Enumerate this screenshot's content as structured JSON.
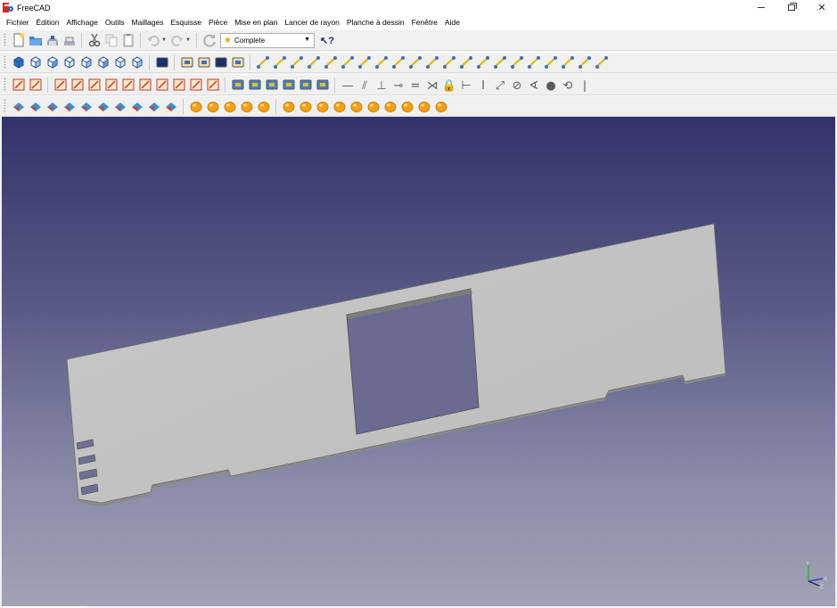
{
  "window": {
    "title": "FreeCAD",
    "minimize_label": "–",
    "close_label": "✕"
  },
  "menu": [
    "Fichier",
    "Édition",
    "Affichage",
    "Outils",
    "Maillages",
    "Esquisse",
    "Pièce",
    "Mise en plan",
    "Lancer de rayon",
    "Planche à dessin",
    "Fenêtre",
    "Aide"
  ],
  "workbench_selector": {
    "value": "Complete"
  },
  "toolbar_icons": {
    "row1": [
      "new-document-icon",
      "open-document-icon",
      "save-icon",
      "save-as-icon",
      "cut-icon",
      "copy-icon",
      "paste-icon",
      "undo-icon",
      "redo-icon",
      "refresh-icon",
      "what-is-this-icon"
    ],
    "row2": [
      "view-fit-all-icon",
      "view-axonometric-icon",
      "view-front-icon",
      "view-top-icon",
      "view-right-icon",
      "view-rear-icon",
      "view-bottom-icon",
      "view-left-icon",
      "measure-icon",
      "new-drawing-page-icon",
      "new-a3-page-icon",
      "insert-view-icon",
      "export-page-icon",
      "draft-line-icon",
      "draft-wire-icon",
      "draft-circle-icon",
      "draft-arc-icon",
      "draft-rectangle-icon",
      "draft-polygon-icon",
      "draft-bspline-icon",
      "draft-text-icon",
      "draft-dimension-icon",
      "draft-move-icon",
      "draft-rotate-icon",
      "draft-offset-icon",
      "draft-trimex-icon",
      "draft-upgrade-icon",
      "draft-downgrade-icon",
      "draft-scale-icon",
      "draft-edit-icon",
      "draft-wire-to-bspline-icon",
      "draft-add-point-icon",
      "draft-del-point-icon",
      "draft-shape-to-2d-icon"
    ],
    "row3": [
      "new-sketch-icon",
      "map-sketch-icon",
      "sketch-point-icon",
      "sketch-polyline-icon",
      "sketch-circle-icon",
      "sketch-line-icon",
      "sketch-arc-icon",
      "sketch-rectangle-icon",
      "sketch-fillet-icon",
      "sketch-trim-icon",
      "sketch-external-icon",
      "sketch-validate-icon",
      "raytracing-new-project-icon",
      "raytracing-insert-part-icon",
      "raytracing-render-icon",
      "raytracing-export-icon",
      "raytracing-dropdown-icon",
      "raytracing-export-view-icon",
      "constrain-point-icon",
      "constrain-tangent-icon",
      "constrain-vertical-icon",
      "constrain-horizontal-icon",
      "constrain-parallel-icon",
      "constrain-perpendicular-icon",
      "constrain-coincident-icon",
      "constrain-equal-icon",
      "constrain-symmetric-icon",
      "constrain-lock-icon",
      "constrain-horizontal-distance-icon",
      "constrain-vertical-distance-icon",
      "constrain-radius-icon",
      "constrain-diameter-icon",
      "constrain-angle-icon"
    ],
    "row4": [
      "mesh-import-icon",
      "mesh-export-icon",
      "mesh-from-shape-icon",
      "mesh-eval-icon",
      "mesh-harmonize-icon",
      "mesh-flip-normals-icon",
      "mesh-fill-holes-icon",
      "mesh-union-icon",
      "mesh-intersection-icon",
      "mesh-difference-icon",
      "part-box-icon",
      "part-cylinder-icon",
      "part-sphere-icon",
      "part-cone-icon",
      "part-torus-icon",
      "part-boolean-icon",
      "part-cut-icon",
      "part-fuse-icon",
      "part-common-icon",
      "part-section-icon",
      "part-extrude-icon",
      "part-revolve-icon",
      "part-mirror-icon",
      "part-fillet-icon",
      "part-chamfer-icon"
    ]
  },
  "colors": {
    "view_top": "#33336b",
    "view_bottom": "#a0a2b4",
    "part_face": "#c3c3c3",
    "part_edge": "#555555"
  },
  "axis_labels": {
    "y": "Y",
    "x": "X",
    "z": "Z"
  }
}
